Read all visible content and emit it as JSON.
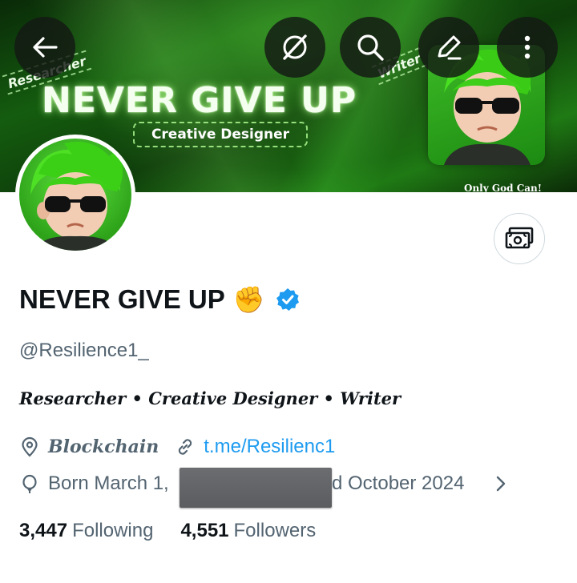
{
  "banner": {
    "title": "NEVER GIVE UP",
    "tag": "Creative Designer",
    "left_ribbon": "Researcher",
    "right_ribbon": "Writer",
    "caption": "Only God Can!"
  },
  "top_buttons": [
    {
      "name": "back",
      "icon": "arrow-left-icon"
    },
    {
      "name": "grok",
      "icon": "grok-icon"
    },
    {
      "name": "search",
      "icon": "search-icon"
    },
    {
      "name": "edit",
      "icon": "pencil-icon"
    },
    {
      "name": "more",
      "icon": "more-vertical-icon"
    }
  ],
  "profile": {
    "display_name": "NEVER GIVE UP",
    "emoji": "✊",
    "verified": true,
    "handle": "@Resilience1_",
    "bio": "Researcher • Creative Designer • Writer",
    "location": "Blockchain",
    "link": "t.me/Resilienc1",
    "born_visible": "Born March 1,",
    "joined_visible": "d October 2024",
    "following_count": "3,447",
    "following_label": "Following",
    "followers_count": "4,551",
    "followers_label": "Followers"
  },
  "colors": {
    "text_primary": "#0f1419",
    "text_secondary": "#536471",
    "link": "#1d9bf0",
    "verified_badge": "#1d9bf0",
    "banner_green": "#1f7a14"
  }
}
